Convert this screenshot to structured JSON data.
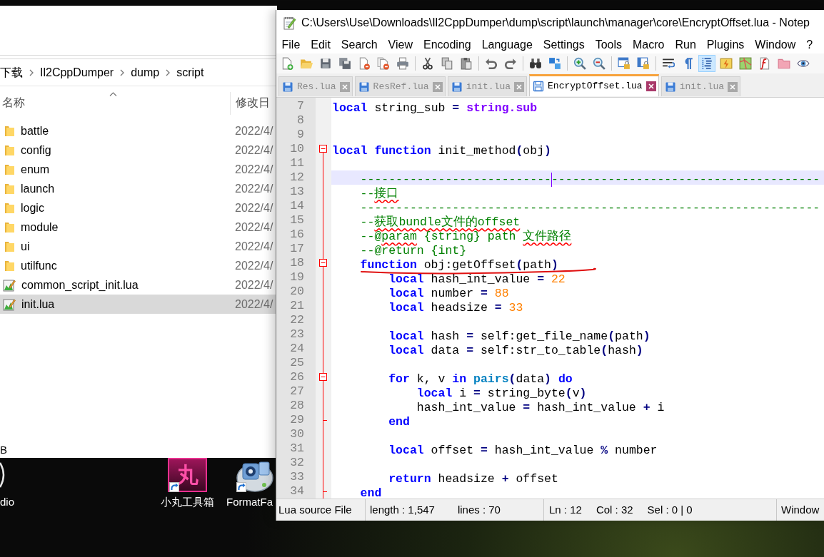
{
  "desktop": {
    "icons": [
      {
        "label": "dio",
        "kind": "disc",
        "shortcut": false
      },
      {
        "label": "小丸工具箱",
        "kind": "tile",
        "glyph": "丸",
        "shortcut": true
      },
      {
        "label": "FormatFa",
        "kind": "reel",
        "shortcut": true
      }
    ]
  },
  "explorer": {
    "breadcrumb": [
      "下载",
      "Il2CppDumper",
      "dump",
      "script"
    ],
    "columns": [
      "名称",
      "修改日"
    ],
    "rows": [
      {
        "name": "battle",
        "kind": "folder",
        "date": "2022/4/",
        "selected": false
      },
      {
        "name": "config",
        "kind": "folder",
        "date": "2022/4/",
        "selected": false
      },
      {
        "name": "enum",
        "kind": "folder",
        "date": "2022/4/",
        "selected": false
      },
      {
        "name": "launch",
        "kind": "folder",
        "date": "2022/4/",
        "selected": false
      },
      {
        "name": "logic",
        "kind": "folder",
        "date": "2022/4/",
        "selected": false
      },
      {
        "name": "module",
        "kind": "folder",
        "date": "2022/4/",
        "selected": false
      },
      {
        "name": "ui",
        "kind": "folder",
        "date": "2022/4/",
        "selected": false
      },
      {
        "name": "utilfunc",
        "kind": "folder",
        "date": "2022/4/",
        "selected": false
      },
      {
        "name": "common_script_init.lua",
        "kind": "lua",
        "date": "2022/4/",
        "selected": false
      },
      {
        "name": "init.lua",
        "kind": "lua",
        "date": "2022/4/",
        "selected": true
      }
    ],
    "status": "B"
  },
  "editor": {
    "title": "C:\\Users\\Use\\Downloads\\Il2CppDumper\\dump\\script\\launch\\manager\\core\\EncryptOffset.lua - Notep",
    "menu": [
      "File",
      "Edit",
      "Search",
      "View",
      "Encoding",
      "Language",
      "Settings",
      "Tools",
      "Macro",
      "Run",
      "Plugins",
      "Window",
      "?"
    ],
    "toolbar": [
      [
        {
          "on": false
        },
        {
          "on": false
        },
        {
          "on": false
        },
        {
          "on": false
        },
        {
          "on": false
        },
        {
          "on": false
        },
        {
          "on": false
        }
      ],
      [
        {
          "on": false
        },
        {
          "on": false
        },
        {
          "on": false
        }
      ],
      [
        {
          "on": false
        },
        {
          "on": false
        }
      ],
      [
        {
          "on": false
        },
        {
          "on": false
        }
      ],
      [
        {
          "on": false
        },
        {
          "on": false
        }
      ],
      [
        {
          "on": false
        },
        {
          "on": false
        }
      ],
      [
        {
          "on": false
        },
        {
          "on": false
        },
        {
          "on": true
        },
        {
          "on": false
        },
        {
          "on": false
        },
        {
          "on": false
        },
        {
          "on": false
        },
        {
          "on": false
        }
      ]
    ],
    "tabs": [
      {
        "label": "Res.lua",
        "selected": false
      },
      {
        "label": "ResRef.lua",
        "selected": false
      },
      {
        "label": "init.lua",
        "selected": false
      },
      {
        "label": "EncryptOffset.lua",
        "selected": true
      },
      {
        "label": "init.lua",
        "selected": false
      }
    ],
    "lines": [
      {
        "number": "7",
        "current": false,
        "marked": false,
        "fold_end": false,
        "tokens": [
          {
            "kind": "keyword",
            "text": "local"
          },
          {
            "kind": "plain",
            "text": " string_sub "
          },
          {
            "kind": "operator",
            "text": "= "
          },
          {
            "kind": "library",
            "text": "string.sub"
          }
        ]
      },
      {
        "number": "8",
        "current": false,
        "marked": false,
        "fold_end": false
      },
      {
        "number": "9",
        "current": false,
        "marked": false,
        "fold_end": false
      },
      {
        "number": "10",
        "current": false,
        "marked": false,
        "fold_end": false,
        "tokens": [
          {
            "kind": "keyword",
            "text": "local function"
          },
          {
            "kind": "plain",
            "text": " init_method"
          },
          {
            "kind": "operator",
            "text": "("
          },
          {
            "kind": "plain",
            "text": "obj"
          },
          {
            "kind": "operator",
            "text": ")"
          }
        ],
        "children": [
          {
            "number": "11",
            "current": false,
            "marked": false,
            "fold_end": false
          },
          {
            "number": "12",
            "current": true,
            "marked": false,
            "fold_end": false,
            "tokens": [
              {
                "kind": "comment",
                "text": "---------------------------"
              },
              {
                "kind": "caret"
              },
              {
                "kind": "comment",
                "text": "--------------------------------------"
              }
            ]
          },
          {
            "number": "13",
            "current": false,
            "marked": false,
            "fold_end": false,
            "tokens": [
              {
                "kind": "comment",
                "text": "--"
              },
              {
                "kind": "flagged",
                "text": "接口"
              }
            ]
          },
          {
            "number": "14",
            "current": false,
            "marked": false,
            "fold_end": false,
            "tokens": [
              {
                "kind": "comment",
                "text": "-----------------------------------------------------------------"
              }
            ]
          },
          {
            "number": "15",
            "current": false,
            "marked": false,
            "fold_end": false,
            "tokens": [
              {
                "kind": "comment",
                "text": "--"
              },
              {
                "kind": "flagged",
                "text": "获取bundle文件的offset"
              }
            ]
          },
          {
            "number": "16",
            "current": false,
            "marked": false,
            "fold_end": false,
            "tokens": [
              {
                "kind": "comment",
                "text": "--@"
              },
              {
                "kind": "flagged",
                "text": "param"
              },
              {
                "kind": "comment",
                "text": " {string} path "
              },
              {
                "kind": "flagged",
                "text": "文件路径"
              }
            ]
          },
          {
            "number": "17",
            "current": false,
            "marked": false,
            "fold_end": false,
            "tokens": [
              {
                "kind": "comment",
                "text": "--@return {int}"
              }
            ]
          },
          {
            "number": "18",
            "current": false,
            "marked": true,
            "fold_end": false,
            "tokens": [
              {
                "kind": "keyword",
                "text": "function"
              },
              {
                "kind": "plain",
                "text": " obj:getOffset"
              },
              {
                "kind": "operator",
                "text": "("
              },
              {
                "kind": "plain",
                "text": "path"
              },
              {
                "kind": "operator",
                "text": ")"
              }
            ],
            "children": [
              {
                "number": "19",
                "current": false,
                "marked": false,
                "fold_end": false,
                "tokens": [
                  {
                    "kind": "keyword",
                    "text": "local"
                  },
                  {
                    "kind": "plain",
                    "text": " hash_int_value "
                  },
                  {
                    "kind": "operator",
                    "text": "= "
                  },
                  {
                    "kind": "number",
                    "text": "22"
                  }
                ]
              },
              {
                "number": "20",
                "current": false,
                "marked": false,
                "fold_end": false,
                "tokens": [
                  {
                    "kind": "keyword",
                    "text": "local"
                  },
                  {
                    "kind": "plain",
                    "text": " number "
                  },
                  {
                    "kind": "operator",
                    "text": "= "
                  },
                  {
                    "kind": "number",
                    "text": "88"
                  }
                ]
              },
              {
                "number": "21",
                "current": false,
                "marked": false,
                "fold_end": false,
                "tokens": [
                  {
                    "kind": "keyword",
                    "text": "local"
                  },
                  {
                    "kind": "plain",
                    "text": " headsize "
                  },
                  {
                    "kind": "operator",
                    "text": "= "
                  },
                  {
                    "kind": "number",
                    "text": "33"
                  }
                ]
              },
              {
                "number": "22",
                "current": false,
                "marked": false,
                "fold_end": false
              },
              {
                "number": "23",
                "current": false,
                "marked": false,
                "fold_end": false,
                "tokens": [
                  {
                    "kind": "keyword",
                    "text": "local"
                  },
                  {
                    "kind": "plain",
                    "text": " hash "
                  },
                  {
                    "kind": "operator",
                    "text": "="
                  },
                  {
                    "kind": "plain",
                    "text": " self:get_file_name"
                  },
                  {
                    "kind": "operator",
                    "text": "("
                  },
                  {
                    "kind": "plain",
                    "text": "path"
                  },
                  {
                    "kind": "operator",
                    "text": ")"
                  }
                ]
              },
              {
                "number": "24",
                "current": false,
                "marked": false,
                "fold_end": false,
                "tokens": [
                  {
                    "kind": "keyword",
                    "text": "local"
                  },
                  {
                    "kind": "plain",
                    "text": " data "
                  },
                  {
                    "kind": "operator",
                    "text": "="
                  },
                  {
                    "kind": "plain",
                    "text": " self:str_to_table"
                  },
                  {
                    "kind": "operator",
                    "text": "("
                  },
                  {
                    "kind": "plain",
                    "text": "hash"
                  },
                  {
                    "kind": "operator",
                    "text": ")"
                  }
                ]
              },
              {
                "number": "25",
                "current": false,
                "marked": false,
                "fold_end": false
              },
              {
                "number": "26",
                "current": false,
                "marked": false,
                "fold_end": false,
                "tokens": [
                  {
                    "kind": "keyword",
                    "text": "for"
                  },
                  {
                    "kind": "plain",
                    "text": " k, v "
                  },
                  {
                    "kind": "keyword",
                    "text": "in "
                  },
                  {
                    "kind": "builtin",
                    "text": "pairs"
                  },
                  {
                    "kind": "operator",
                    "text": "("
                  },
                  {
                    "kind": "plain",
                    "text": "data"
                  },
                  {
                    "kind": "operator",
                    "text": ") "
                  },
                  {
                    "kind": "keyword",
                    "text": "do"
                  }
                ],
                "children": [
                  {
                    "number": "27",
                    "current": false,
                    "marked": false,
                    "fold_end": false,
                    "tokens": [
                      {
                        "kind": "keyword",
                        "text": "local"
                      },
                      {
                        "kind": "plain",
                        "text": " i "
                      },
                      {
                        "kind": "operator",
                        "text": "="
                      },
                      {
                        "kind": "plain",
                        "text": " string_byte"
                      },
                      {
                        "kind": "operator",
                        "text": "("
                      },
                      {
                        "kind": "plain",
                        "text": "v"
                      },
                      {
                        "kind": "operator",
                        "text": ")"
                      }
                    ]
                  },
                  {
                    "number": "28",
                    "current": false,
                    "marked": false,
                    "fold_end": false,
                    "tokens": [
                      {
                        "kind": "plain",
                        "text": "hash_int_value "
                      },
                      {
                        "kind": "operator",
                        "text": "="
                      },
                      {
                        "kind": "plain",
                        "text": " hash_int_value "
                      },
                      {
                        "kind": "operator",
                        "text": "+"
                      },
                      {
                        "kind": "plain",
                        "text": " i"
                      }
                    ]
                  }
                ]
              },
              {
                "number": "29",
                "current": false,
                "marked": false,
                "fold_end": true,
                "tokens": [
                  {
                    "kind": "keyword",
                    "text": "end"
                  }
                ]
              },
              {
                "number": "30",
                "current": false,
                "marked": false,
                "fold_end": false
              },
              {
                "number": "31",
                "current": false,
                "marked": false,
                "fold_end": false,
                "tokens": [
                  {
                    "kind": "keyword",
                    "text": "local"
                  },
                  {
                    "kind": "plain",
                    "text": " offset "
                  },
                  {
                    "kind": "operator",
                    "text": "="
                  },
                  {
                    "kind": "plain",
                    "text": " hash_int_value "
                  },
                  {
                    "kind": "operator",
                    "text": "%"
                  },
                  {
                    "kind": "plain",
                    "text": " number"
                  }
                ]
              },
              {
                "number": "32",
                "current": false,
                "marked": false,
                "fold_end": false
              },
              {
                "number": "33",
                "current": false,
                "marked": false,
                "fold_end": false,
                "tokens": [
                  {
                    "kind": "keyword",
                    "text": "return"
                  },
                  {
                    "kind": "plain",
                    "text": " headsize "
                  },
                  {
                    "kind": "operator",
                    "text": "+"
                  },
                  {
                    "kind": "plain",
                    "text": " offset"
                  }
                ]
              }
            ]
          },
          {
            "number": "34",
            "current": false,
            "marked": false,
            "fold_end": true,
            "tokens": [
              {
                "kind": "keyword",
                "text": "end"
              }
            ]
          }
        ]
      }
    ],
    "status_bar": [
      [
        "Lua source File"
      ],
      [
        "length : 1,547",
        "lines : 70"
      ],
      [
        "Ln : 12",
        "Col : 32",
        "Sel : 0 | 0"
      ],
      [
        "Window"
      ]
    ]
  }
}
